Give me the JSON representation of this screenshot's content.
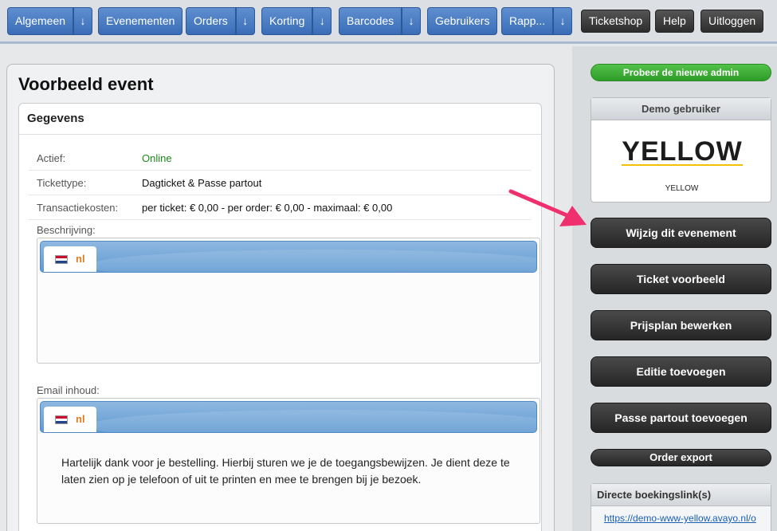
{
  "nav": {
    "menus": [
      {
        "label": "Algemeen",
        "has_dropdown": true
      },
      {
        "label": "Evenementen",
        "has_dropdown": false
      },
      {
        "label": "Orders",
        "has_dropdown": true
      },
      {
        "label": "Korting",
        "has_dropdown": true
      },
      {
        "label": "Barcodes",
        "has_dropdown": true
      },
      {
        "label": "Gebruikers",
        "has_dropdown": false
      },
      {
        "label": "Rapp...",
        "has_dropdown": true
      }
    ],
    "dropdown_arrow": "↓",
    "ticketshop_label": "Ticketshop",
    "help_label": "Help",
    "logout_label": "Uitloggen"
  },
  "page": {
    "title": "Voorbeeld event",
    "card_title": "Gegevens",
    "details": [
      {
        "label": "Actief:",
        "value": "Online"
      },
      {
        "label": "Tickettype:",
        "value": "Dagticket & Passe partout"
      },
      {
        "label": "Transactiekosten:",
        "value": "per ticket: € 0,00 - per order: € 0,00 - maximaal: € 0,00"
      }
    ],
    "description": {
      "label": "Beschrijving:",
      "language": "nl",
      "text": ""
    },
    "email": {
      "label": "Email inhoud:",
      "language": "nl",
      "text": "Hartelijk dank voor je bestelling. Hierbij sturen we je de toegangsbewijzen. Je dient deze te laten zien op je telefoon of uit te printen en mee te brengen bij je bezoek."
    }
  },
  "sidebar": {
    "try_new_admin": "Probeer de nieuwe admin",
    "demo_user": {
      "header": "Demo gebruiker",
      "logo_text": "YELLOW",
      "name": "YELLOW"
    },
    "actions": [
      "Wijzig dit evenement",
      "Ticket voorbeeld",
      "Prijsplan bewerken",
      "Editie toevoegen",
      "Passe partout toevoegen",
      "Order export"
    ],
    "booking_links": {
      "header": "Directe boekingslink(s)",
      "url": "https://demo-www-yellow.avayo.nl/o"
    }
  },
  "colors": {
    "nav_blue": "#3a6db7",
    "dark_button": "#2d2d2d",
    "online_green": "#1a8a1a",
    "try_green": "#2e9b28",
    "language_code": "#e07a1f",
    "annotation_arrow": "#f0306e"
  },
  "icons": {
    "dropdown": "arrow-down-icon",
    "language_flag": "netherlands-flag-icon"
  }
}
